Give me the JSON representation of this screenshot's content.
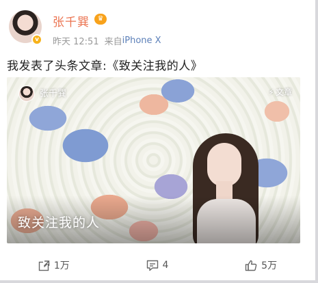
{
  "user": {
    "name": "张千巽",
    "verified_mark": "v",
    "vip_badge": "♛"
  },
  "meta": {
    "date": "昨天 12:51",
    "from_label": "来自",
    "device": "iPhone X"
  },
  "post": {
    "text": "我发表了头条文章:《致关注我的人》"
  },
  "card": {
    "author": "张千巽",
    "tag": "文章",
    "tag_icon": "⚡",
    "title": "致关注我的人"
  },
  "actions": {
    "repost": "1万",
    "comment": "4",
    "like": "5万"
  },
  "colors": {
    "name": "#eb7350",
    "device": "#5b7fb8",
    "vip": "#f8a21b"
  }
}
